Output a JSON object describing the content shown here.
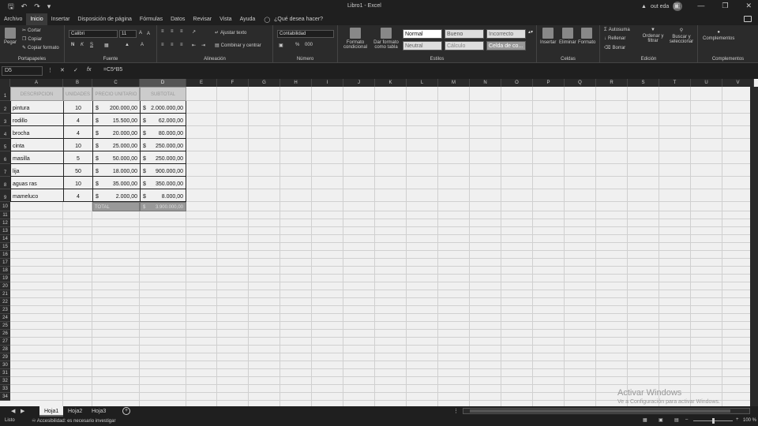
{
  "window": {
    "title": "Libro1 - Excel",
    "user": "out eda",
    "avatar_initials": "OE"
  },
  "menu": {
    "tabs": [
      "Archivo",
      "Inicio",
      "Insertar",
      "Disposición de página",
      "Fórmulas",
      "Datos",
      "Revisar",
      "Vista",
      "Ayuda"
    ],
    "active": "Inicio",
    "tell_me": "¿Qué desea hacer?"
  },
  "ribbon": {
    "clipboard": {
      "paste": "Pegar",
      "cut": "Cortar",
      "copy": "Copiar",
      "format_painter": "Copiar formato",
      "label": "Portapapeles"
    },
    "font": {
      "name": "Calibri",
      "size": "11",
      "label": "Fuente",
      "bold": "N",
      "italic": "K",
      "underline": "S"
    },
    "alignment": {
      "wrap": "Ajustar texto",
      "merge": "Combinar y centrar",
      "label": "Alineación"
    },
    "number": {
      "format": "Contabilidad",
      "label": "Número",
      "percent": "%",
      "thousands": "000"
    },
    "styles": {
      "conditional": "Formato condicional",
      "table": "Dar formato como tabla",
      "cells": [
        "Normal",
        "Bueno",
        "Incorrecto",
        "Neutral",
        "Cálculo",
        "Celda de co..."
      ],
      "label": "Estilos"
    },
    "cells": {
      "insert": "Insertar",
      "delete": "Eliminar",
      "format": "Formato",
      "label": "Celdas"
    },
    "editing": {
      "autosum": "Autosuma",
      "fill": "Rellenar",
      "clear": "Borrar",
      "sort": "Ordenar y filtrar",
      "find": "Buscar y seleccionar",
      "label": "Edición"
    },
    "addins": {
      "button": "Complementos",
      "label": "Complementos"
    }
  },
  "formula_bar": {
    "cell": "D5",
    "formula": "=C5*B5"
  },
  "columns": [
    "A",
    "B",
    "C",
    "D",
    "E",
    "F",
    "G",
    "H",
    "I",
    "J",
    "K",
    "L",
    "M",
    "N",
    "O",
    "P",
    "Q",
    "R",
    "S",
    "T",
    "U",
    "V"
  ],
  "rows": [
    "1",
    "2",
    "3",
    "4",
    "5",
    "6",
    "7",
    "8",
    "9",
    "10",
    "11",
    "12",
    "13",
    "14",
    "15",
    "16",
    "17",
    "18",
    "19",
    "20",
    "21",
    "22",
    "23",
    "24",
    "25",
    "26",
    "27",
    "28",
    "29",
    "30",
    "31",
    "32",
    "33",
    "34"
  ],
  "table": {
    "headers": [
      "DESCRIPCION",
      "UNIDADES",
      "PRECIO UNITARIO",
      "SUBTOTAL"
    ],
    "rows": [
      {
        "desc": "pintura",
        "units": "10",
        "price": "200.000,00",
        "subtotal": "2.000.000,00"
      },
      {
        "desc": "rodillo",
        "units": "4",
        "price": "15.500,00",
        "subtotal": "62.000,00"
      },
      {
        "desc": "brocha",
        "units": "4",
        "price": "20.000,00",
        "subtotal": "80.000,00"
      },
      {
        "desc": "cinta",
        "units": "10",
        "price": "25.000,00",
        "subtotal": "250.000,00"
      },
      {
        "desc": "masilla",
        "units": "5",
        "price": "50.000,00",
        "subtotal": "250.000,00"
      },
      {
        "desc": "lija",
        "units": "50",
        "price": "18.000,00",
        "subtotal": "900.000,00"
      },
      {
        "desc": "aguas ras",
        "units": "10",
        "price": "35.000,00",
        "subtotal": "350.000,00"
      },
      {
        "desc": "mameluco",
        "units": "4",
        "price": "2.000,00",
        "subtotal": "8.000,00"
      }
    ],
    "currency": "$",
    "total_label": "TOTAL",
    "total_value": "3.900.000,00"
  },
  "sheets": [
    "Hoja1",
    "Hoja2",
    "Hoja3"
  ],
  "active_sheet": "Hoja1",
  "status": {
    "ready": "Listo",
    "accessibility": "Accesibilidad: es necesario investigar",
    "zoom": "100 %"
  },
  "watermark": {
    "title": "Activar Windows",
    "subtitle": "Ve a Configuración para activar Windows."
  }
}
